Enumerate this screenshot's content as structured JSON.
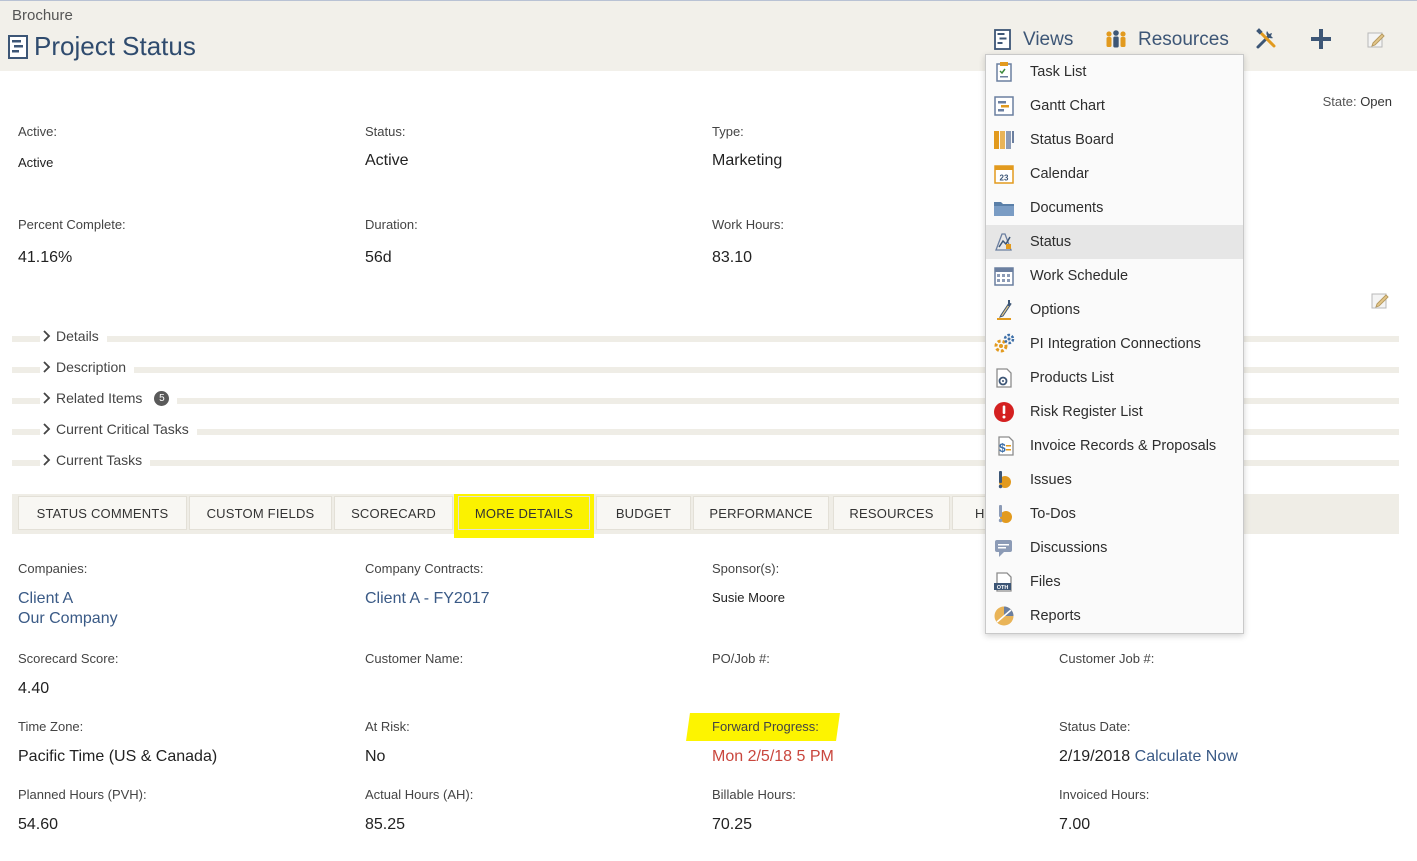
{
  "header": {
    "breadcrumb": "Brochure",
    "title": "Project Status",
    "views_label": "Views",
    "resources_label": "Resources"
  },
  "state": {
    "label": "State:",
    "value": "Open"
  },
  "summary": {
    "active_label": "Active:",
    "active_value": "Active",
    "status_label": "Status:",
    "status_value": "Active",
    "type_label": "Type:",
    "type_value": "Marketing",
    "percent_label": "Percent Complete:",
    "percent_value": "41.16%",
    "duration_label": "Duration:",
    "duration_value": "56d",
    "workhours_label": "Work Hours:",
    "workhours_value": "83.10"
  },
  "sections": {
    "details": "Details",
    "description": "Description",
    "related": "Related Items",
    "related_count": "5",
    "critical": "Current Critical Tasks",
    "current": "Current Tasks"
  },
  "tabs": {
    "status_comments": "STATUS COMMENTS",
    "custom_fields": "CUSTOM FIELDS",
    "scorecard": "SCORECARD",
    "more_details": "MORE DETAILS",
    "budget": "BUDGET",
    "performance": "PERFORMANCE",
    "resources": "RESOURCES",
    "history_partial": "H"
  },
  "details": {
    "companies_label": "Companies:",
    "companies_1": "Client A",
    "companies_2": "Our Company",
    "contracts_label": "Company Contracts:",
    "contracts_value": "Client A - FY2017",
    "sponsors_label": "Sponsor(s):",
    "sponsors_value": "Susie Moore",
    "scorecard_label": "Scorecard Score:",
    "scorecard_value": "4.40",
    "customer_name_label": "Customer Name:",
    "po_label": "PO/Job #:",
    "customer_job_label": "Customer Job #:",
    "timezone_label": "Time Zone:",
    "timezone_value": "Pacific Time (US & Canada)",
    "atrisk_label": "At Risk:",
    "atrisk_value": "No",
    "forward_label": "Forward Progress:",
    "forward_value": "Mon 2/5/18 5 PM",
    "statusdate_label": "Status Date:",
    "statusdate_value": "2/19/2018",
    "calculate_label": "Calculate Now",
    "planned_label": "Planned Hours (PVH):",
    "planned_value": "54.60",
    "actual_label": "Actual Hours (AH):",
    "actual_value": "85.25",
    "billable_label": "Billable Hours:",
    "billable_value": "70.25",
    "invoiced_label": "Invoiced Hours:",
    "invoiced_value": "7.00"
  },
  "views_menu": {
    "items": [
      {
        "label": "Task List",
        "icon": "task-list-icon"
      },
      {
        "label": "Gantt Chart",
        "icon": "gantt-chart-icon"
      },
      {
        "label": "Status Board",
        "icon": "status-board-icon"
      },
      {
        "label": "Calendar",
        "icon": "calendar-icon",
        "icon_text": "23"
      },
      {
        "label": "Documents",
        "icon": "folder-icon"
      },
      {
        "label": "Status",
        "icon": "status-icon",
        "selected": true
      },
      {
        "label": "Work Schedule",
        "icon": "work-schedule-icon"
      },
      {
        "label": "Options",
        "icon": "options-icon"
      },
      {
        "label": "PI Integration Connections",
        "icon": "integration-gears-icon"
      },
      {
        "label": "Products List",
        "icon": "products-list-icon"
      },
      {
        "label": "Risk Register List",
        "icon": "risk-alert-icon"
      },
      {
        "label": "Invoice Records & Proposals",
        "icon": "invoice-icon"
      },
      {
        "label": "Issues",
        "icon": "issues-icon"
      },
      {
        "label": "To-Dos",
        "icon": "todos-icon"
      },
      {
        "label": "Discussions",
        "icon": "discussions-icon"
      },
      {
        "label": "Files",
        "icon": "files-icon",
        "icon_text": "OTH"
      },
      {
        "label": "Reports",
        "icon": "reports-icon"
      }
    ]
  }
}
